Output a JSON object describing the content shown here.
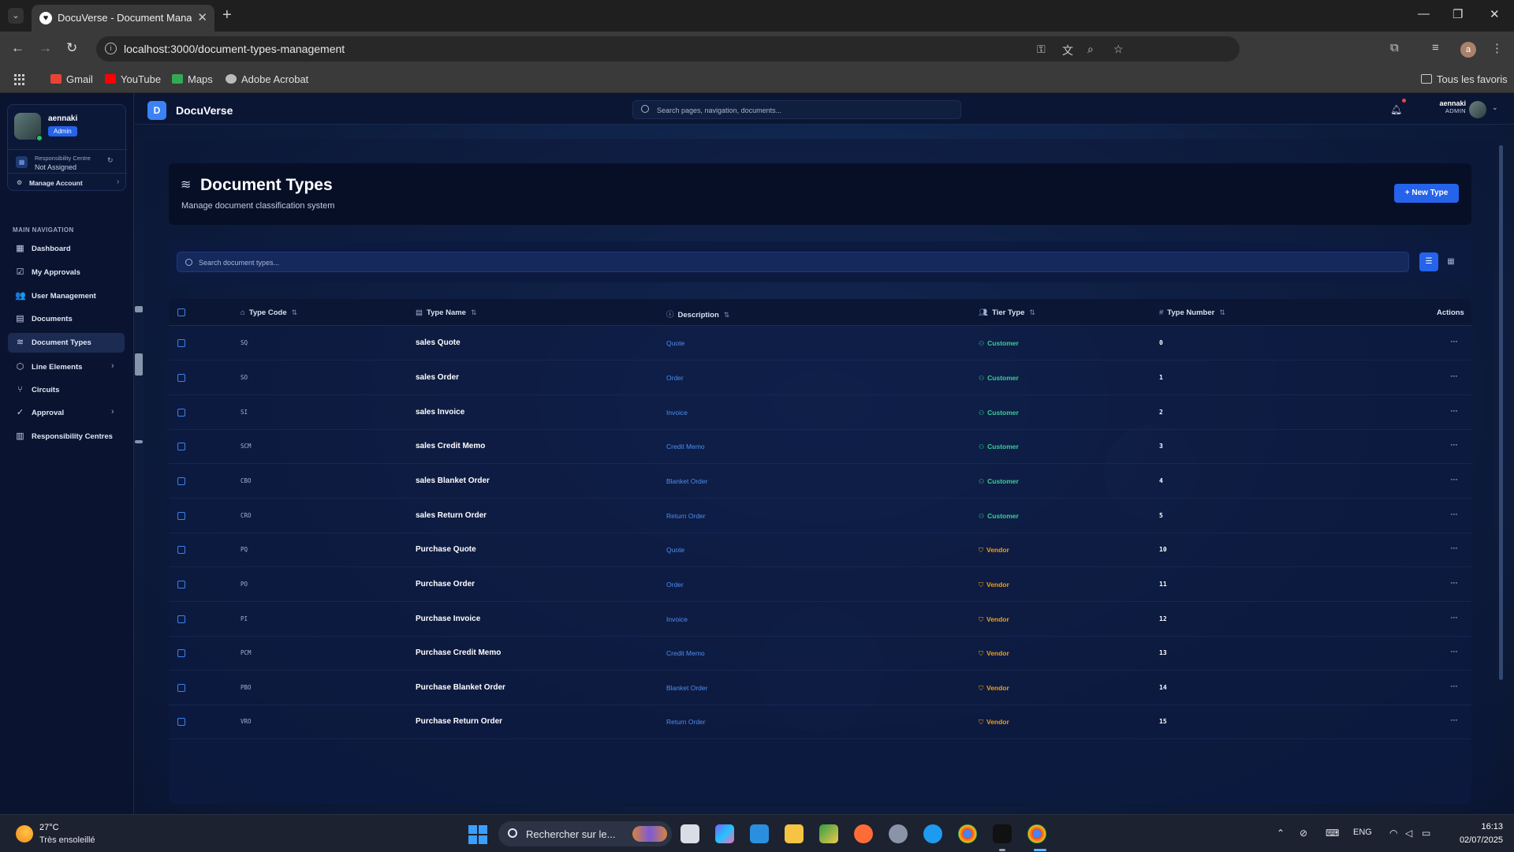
{
  "browser": {
    "tab_title": "DocuVerse - Document Management",
    "url": "localhost:3000/document-types-management",
    "profile_initial": "a",
    "bookmarks": [
      "Gmail",
      "YouTube",
      "Maps",
      "Adobe Acrobat"
    ],
    "all_bookmarks": "Tous les favoris"
  },
  "sidebar": {
    "user": {
      "name": "aennaki",
      "role": "Admin"
    },
    "responsibility": {
      "label": "Responsibility Centre",
      "value": "Not Assigned"
    },
    "manage_account": "Manage Account",
    "nav_heading": "MAIN NAVIGATION",
    "items": [
      {
        "label": "Dashboard",
        "icon": "dashboard-icon"
      },
      {
        "label": "My Approvals",
        "icon": "approvals-icon"
      },
      {
        "label": "User Management",
        "icon": "users-icon"
      },
      {
        "label": "Documents",
        "icon": "document-icon"
      },
      {
        "label": "Document Types",
        "icon": "layers-icon",
        "active": true
      },
      {
        "label": "Line Elements",
        "icon": "cube-icon",
        "expandable": true
      },
      {
        "label": "Circuits",
        "icon": "circuit-icon"
      },
      {
        "label": "Approval",
        "icon": "approval-icon",
        "expandable": true
      },
      {
        "label": "Responsibility Centres",
        "icon": "building-icon"
      }
    ]
  },
  "topbar": {
    "logo_letter": "D",
    "app_name": "DocuVerse",
    "search_placeholder": "Search pages, navigation, documents...",
    "user_name": "aennaki",
    "user_role": "ADMIN"
  },
  "page": {
    "title": "Document Types",
    "subtitle": "Manage document classification system",
    "new_button": "New Type",
    "search_placeholder": "Search document types..."
  },
  "table": {
    "columns": [
      "Type Code",
      "Type Name",
      "Description",
      "Tier Type",
      "Type Number",
      "Actions"
    ],
    "rows": [
      {
        "code": "SQ",
        "name": "sales Quote",
        "desc": "Quote",
        "tier": "Customer",
        "num": "0"
      },
      {
        "code": "SO",
        "name": "sales Order",
        "desc": "Order",
        "tier": "Customer",
        "num": "1"
      },
      {
        "code": "SI",
        "name": "sales Invoice",
        "desc": "Invoice",
        "tier": "Customer",
        "num": "2"
      },
      {
        "code": "SCM",
        "name": "sales Credit Memo",
        "desc": "Credit Memo",
        "tier": "Customer",
        "num": "3"
      },
      {
        "code": "CBO",
        "name": "sales Blanket Order",
        "desc": "Blanket Order",
        "tier": "Customer",
        "num": "4"
      },
      {
        "code": "CRO",
        "name": "sales Return Order",
        "desc": "Return Order",
        "tier": "Customer",
        "num": "5"
      },
      {
        "code": "PQ",
        "name": "Purchase Quote",
        "desc": "Quote",
        "tier": "Vendor",
        "num": "10"
      },
      {
        "code": "PO",
        "name": "Purchase Order",
        "desc": "Order",
        "tier": "Vendor",
        "num": "11"
      },
      {
        "code": "PI",
        "name": "Purchase Invoice",
        "desc": "Invoice",
        "tier": "Vendor",
        "num": "12"
      },
      {
        "code": "PCM",
        "name": "Purchase Credit Memo",
        "desc": "Credit Memo",
        "tier": "Vendor",
        "num": "13"
      },
      {
        "code": "PBO",
        "name": "Purchase Blanket Order",
        "desc": "Blanket Order",
        "tier": "Vendor",
        "num": "14"
      },
      {
        "code": "VRO",
        "name": "Purchase Return Order",
        "desc": "Return Order",
        "tier": "Vendor",
        "num": "15"
      }
    ]
  },
  "taskbar": {
    "temperature": "27°C",
    "weather": "Très ensoleillé",
    "search_text": "Rechercher sur le...",
    "language": "ENG",
    "time": "16:13",
    "date": "02/07/2025"
  },
  "colors": {
    "accent": "#2563eb",
    "customer": "#34d399",
    "vendor": "#f59e0b",
    "link": "#4d8ff0"
  }
}
